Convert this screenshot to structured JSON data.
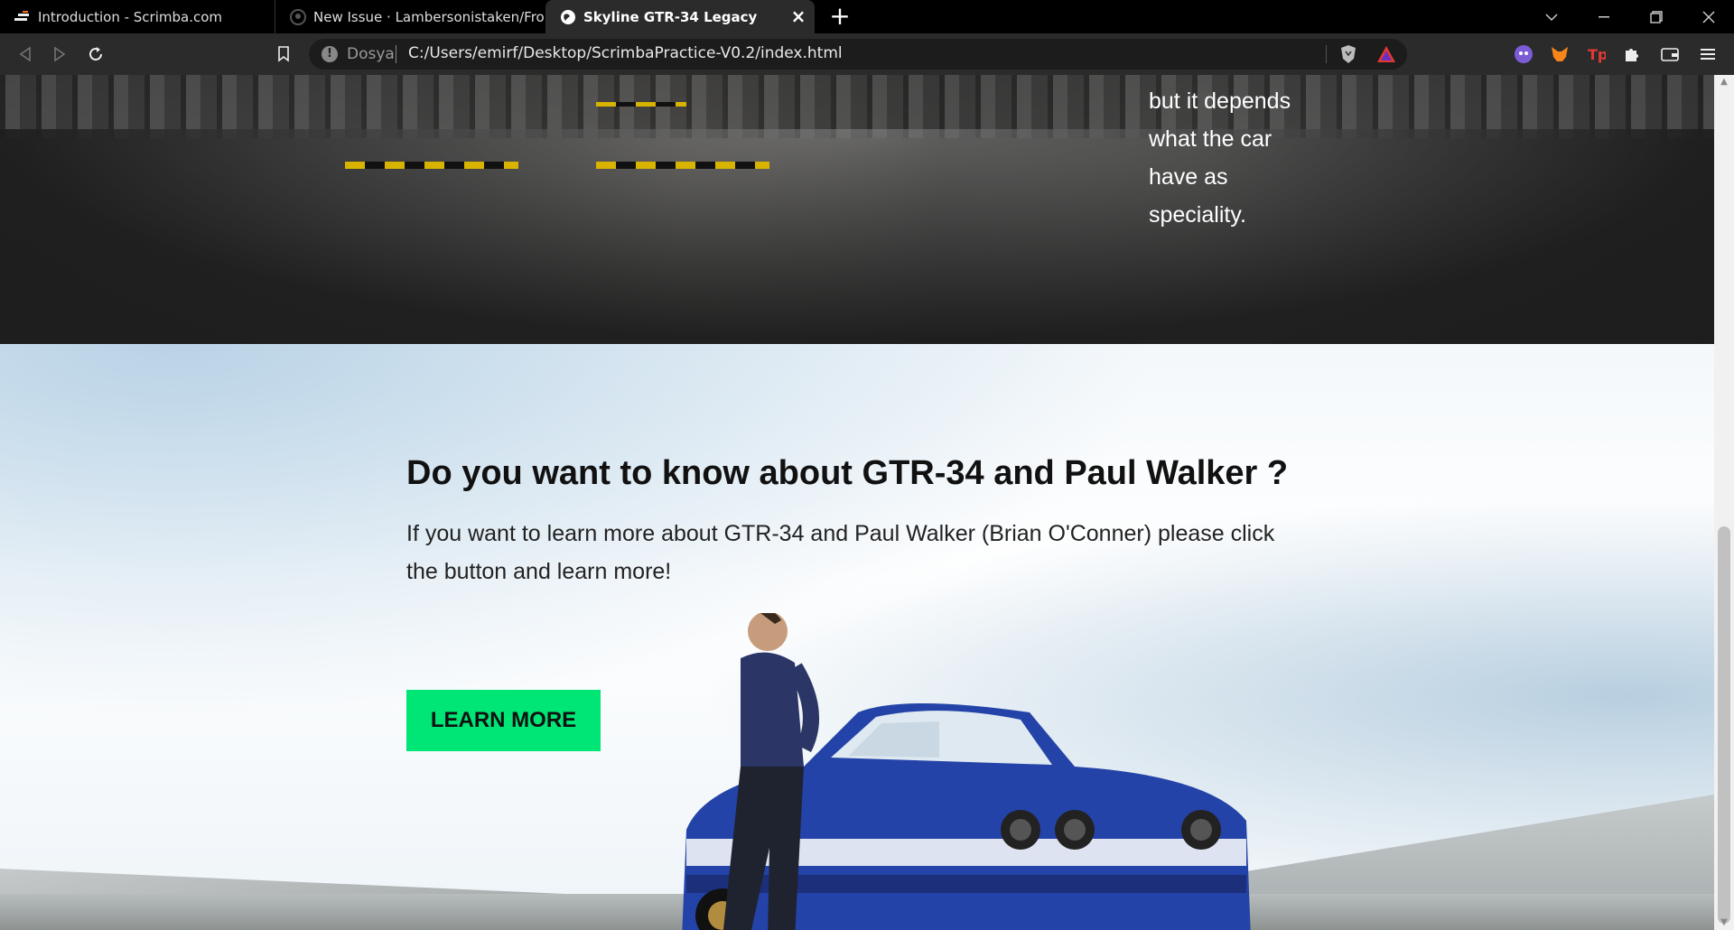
{
  "browser": {
    "tabs": [
      {
        "title": "Introduction - Scrimba.com",
        "icon": "scrimba-icon"
      },
      {
        "title": "New Issue · Lambersonistaken/Fronten",
        "icon": "github-icon"
      },
      {
        "title": "Skyline GTR-34 Legacy",
        "icon": "globe-icon",
        "active": true
      }
    ],
    "address": {
      "site_label": "Dosya",
      "url": "C:/Users/emirf/Desktop/ScrimbaPractice-V0.2/index.html"
    }
  },
  "page": {
    "garage_text": [
      "but it depends",
      "what the car",
      "have as",
      "speciality."
    ],
    "hero": {
      "heading": "Do you want to know about GTR-34 and Paul Walker ?",
      "body_line1": "If you want to learn more about GTR-34 and Paul Walker (Brian O'Conner) please click",
      "body_line2": "the button and learn more!",
      "button_label": "LEARN MORE"
    }
  },
  "colors": {
    "button_bg": "#00e676",
    "browser_bg": "#000000",
    "toolbar_bg": "#2b2b2b"
  }
}
